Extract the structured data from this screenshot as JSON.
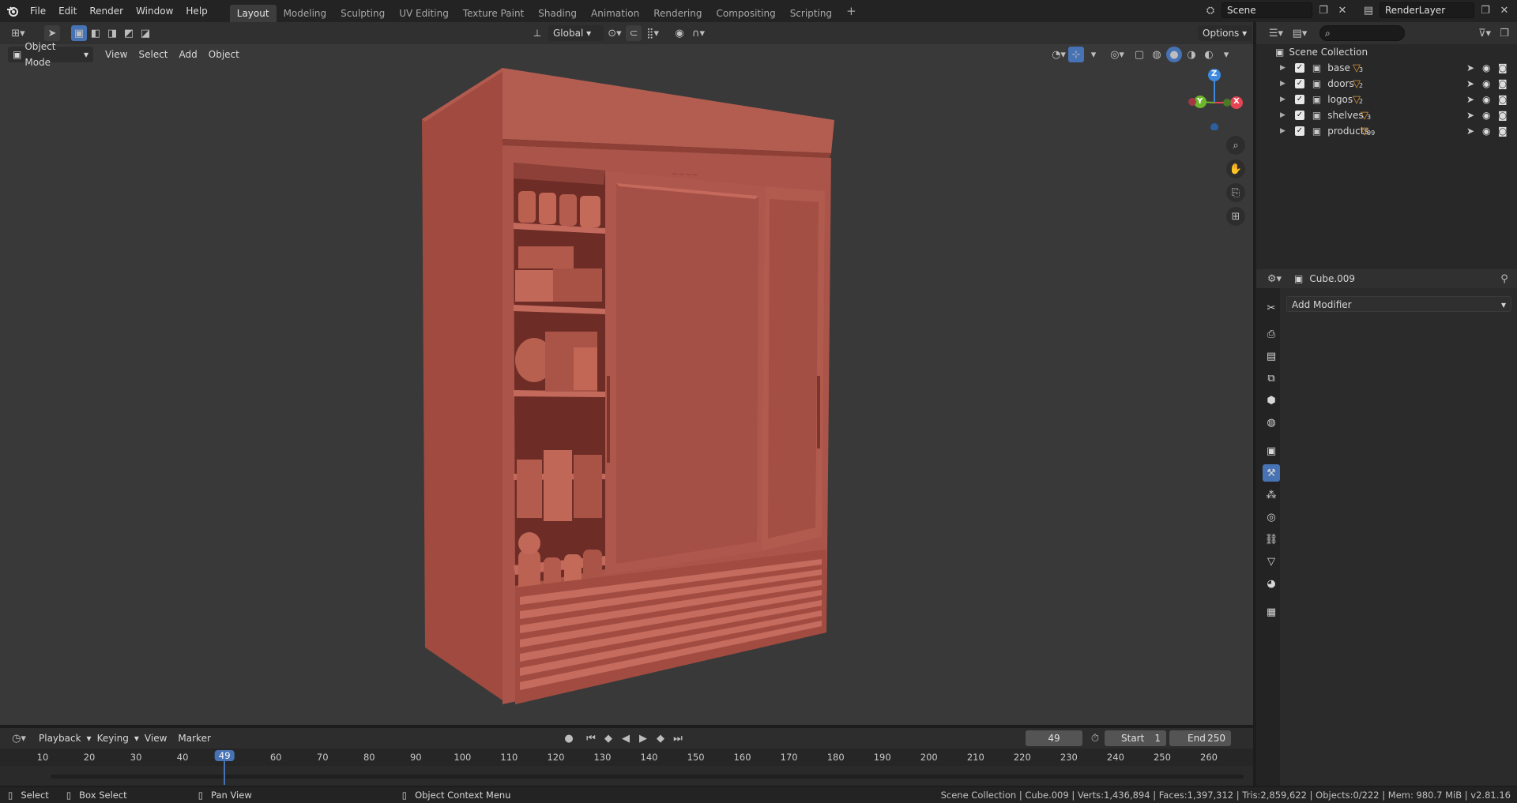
{
  "topbar": {
    "menus": [
      "File",
      "Edit",
      "Render",
      "Window",
      "Help"
    ],
    "workspaces": [
      "Layout",
      "Modeling",
      "Sculpting",
      "UV Editing",
      "Texture Paint",
      "Shading",
      "Animation",
      "Rendering",
      "Compositing",
      "Scripting"
    ],
    "active_workspace": "Layout",
    "add_label": "+",
    "scene": "Scene",
    "render_layer": "RenderLayer"
  },
  "tool_header": {
    "transform_orientation": "Global",
    "options_label": "Options"
  },
  "viewport_header": {
    "mode": "Object Mode",
    "menus": [
      "View",
      "Select",
      "Add",
      "Object"
    ]
  },
  "gizmo": {
    "z": "Z",
    "y": "Y",
    "x": "X"
  },
  "outliner": {
    "search_placeholder": "",
    "collection_title": "Scene Collection",
    "rows": [
      {
        "name": "base",
        "count": "3"
      },
      {
        "name": "doors",
        "count": "2"
      },
      {
        "name": "logos",
        "count": "2"
      },
      {
        "name": "shelves",
        "count": "3"
      },
      {
        "name": "products",
        "count": "99"
      }
    ]
  },
  "properties": {
    "object_name": "Cube.009",
    "add_modifier": "Add Modifier"
  },
  "timeline": {
    "menus": [
      "Playback",
      "Keying",
      "View",
      "Marker"
    ],
    "current_frame": "49",
    "start_label": "Start",
    "start_value": "1",
    "end_label": "End",
    "end_value": "250",
    "ticks": [
      "10",
      "20",
      "30",
      "40",
      "49",
      "60",
      "70",
      "80",
      "90",
      "100",
      "110",
      "120",
      "130",
      "140",
      "150",
      "160",
      "170",
      "180",
      "190",
      "200",
      "210",
      "220",
      "230",
      "240",
      "250",
      "260"
    ]
  },
  "statusbar": {
    "select": "Select",
    "box_select": "Box Select",
    "pan_view": "Pan View",
    "context_menu": "Object Context Menu",
    "stats": "Scene Collection | Cube.009 | Verts:1,436,894 | Faces:1,397,312 | Tris:2,859,622 | Objects:0/222 | Mem: 980.7 MiB | v2.81.16"
  },
  "colors": {
    "model": "#b0584c",
    "viewport_bg": "#393939",
    "accent": "#4772b3",
    "gizmo_x": "#e54454",
    "gizmo_y": "#6cb62c",
    "gizmo_z": "#3e8ae0"
  }
}
